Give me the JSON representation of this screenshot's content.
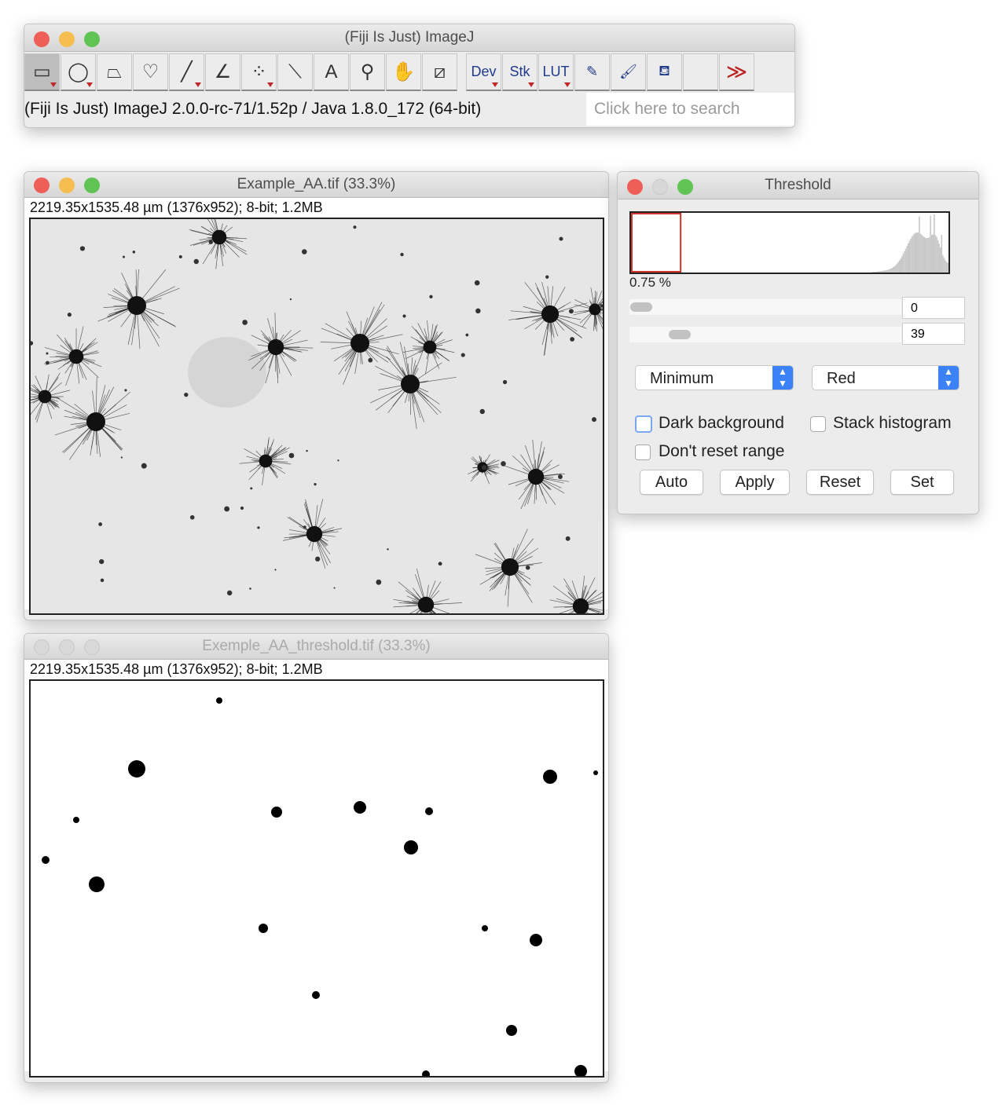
{
  "main_window": {
    "title": "(Fiji Is Just) ImageJ",
    "tools": [
      {
        "name": "rectangle-tool",
        "glyph": "▭",
        "menu": true,
        "selected": true
      },
      {
        "name": "oval-tool",
        "glyph": "◯",
        "menu": true
      },
      {
        "name": "polygon-tool",
        "glyph": "⏢",
        "menu": false
      },
      {
        "name": "freehand-tool",
        "glyph": "♡",
        "menu": false
      },
      {
        "name": "line-tool",
        "glyph": "╱",
        "menu": true
      },
      {
        "name": "angle-tool",
        "glyph": "∠",
        "menu": false
      },
      {
        "name": "multipoint-tool",
        "glyph": "⁘",
        "menu": true
      },
      {
        "name": "wand-tool",
        "glyph": "⟍",
        "menu": false
      },
      {
        "name": "text-tool",
        "glyph": "A",
        "menu": false
      },
      {
        "name": "magnifier-tool",
        "glyph": "⚲",
        "menu": false
      },
      {
        "name": "hand-tool",
        "glyph": "✋",
        "menu": false
      },
      {
        "name": "color-picker-tool",
        "glyph": "⧄",
        "menu": false
      }
    ],
    "tools_right": [
      {
        "name": "dev-menu",
        "label": "Dev",
        "menu": true
      },
      {
        "name": "stk-menu",
        "label": "Stk",
        "menu": true
      },
      {
        "name": "lut-menu",
        "label": "LUT",
        "menu": true
      },
      {
        "name": "pencil-tool",
        "label": "✎",
        "menu": false
      },
      {
        "name": "brush-tool",
        "label": "🖌",
        "menu": false
      },
      {
        "name": "flood-fill-tool",
        "label": "⛾",
        "menu": false
      },
      {
        "name": "empty-slot",
        "label": "",
        "menu": false
      },
      {
        "name": "more-tools",
        "label": "≫",
        "menu": false
      }
    ],
    "status": "(Fiji Is Just) ImageJ 2.0.0-rc-71/1.52p / Java 1.8.0_172 (64-bit)",
    "search_placeholder": "Click here to search"
  },
  "image_window": {
    "title": "Example_AA.tif (33.3%)",
    "info": "2219.35x1535.48 µm (1376x952); 8-bit; 1.2MB"
  },
  "threshold_image_window": {
    "title": "Exemple_AA_threshold.tif (33.3%)",
    "info": "2219.35x1535.48 µm (1376x952); 8-bit; 1.2MB"
  },
  "threshold": {
    "title": "Threshold",
    "percent": "0.75 %",
    "min_value": "0",
    "max_value": "39",
    "min_slider_fraction": 0.0,
    "max_slider_fraction": 0.153,
    "method": "Minimum",
    "mode": "Red",
    "dark_background_label": "Dark background",
    "dark_background": false,
    "stack_histogram_label": "Stack histogram",
    "stack_histogram": false,
    "dont_reset_label": "Don't reset range",
    "dont_reset": false,
    "buttons": {
      "auto": "Auto",
      "apply": "Apply",
      "reset": "Reset",
      "set": "Set"
    },
    "colors": {
      "threshold_box": "#d0352b",
      "histogram": "#c8c8c8"
    }
  }
}
